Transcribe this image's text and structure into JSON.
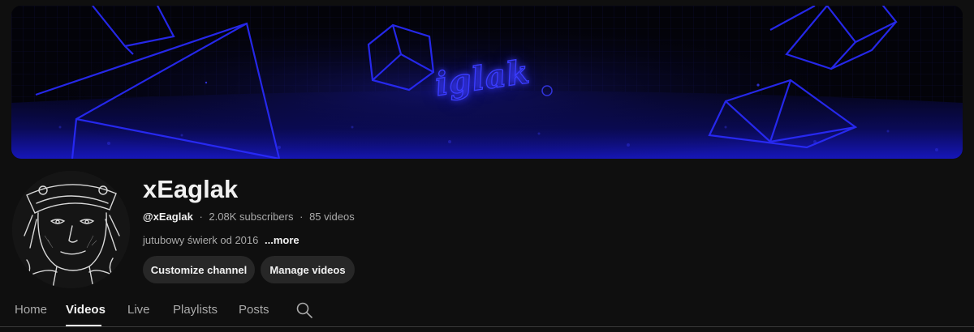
{
  "banner": {
    "title_text": "iglak",
    "accent_color": "#2a2cff"
  },
  "channel": {
    "name": "xEaglak",
    "handle": "@xEaglak",
    "separator": "·",
    "subscribers": "2.08K subscribers",
    "videos": "85 videos",
    "description": "jutubowy świerk od 2016",
    "more_label": "...more"
  },
  "buttons": {
    "customize": "Customize channel",
    "manage": "Manage videos"
  },
  "tabs": [
    {
      "label": "Home",
      "active": false
    },
    {
      "label": "Videos",
      "active": true
    },
    {
      "label": "Live",
      "active": false
    },
    {
      "label": "Playlists",
      "active": false
    },
    {
      "label": "Posts",
      "active": false
    }
  ],
  "icons": {
    "search": "search-icon"
  }
}
